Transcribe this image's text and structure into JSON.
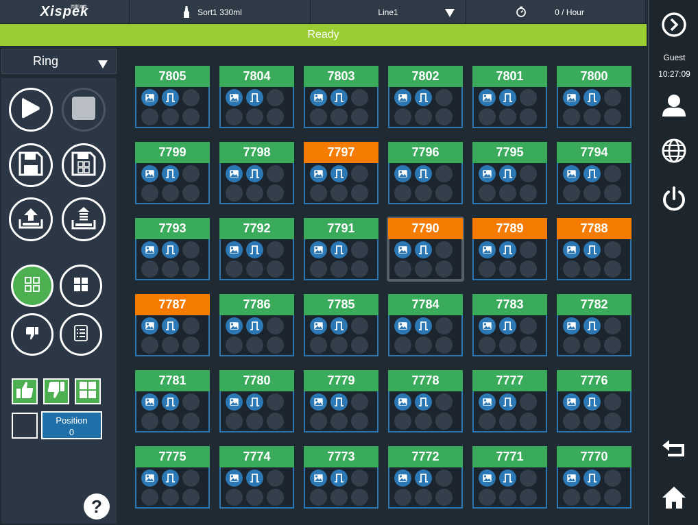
{
  "header": {
    "logo": "Xispek",
    "logo_sub": "西斯派克",
    "product": "Sort1 330ml",
    "line": "Line1",
    "rate": "0 / Hour",
    "status": "Ready",
    "status_color": "#9acd32"
  },
  "left": {
    "mode": "Ring",
    "position_label": "Position",
    "position_value": "0",
    "help": "?"
  },
  "right": {
    "user": "Guest",
    "time": "10:27:09"
  },
  "colors": {
    "ok": "#3aab5b",
    "reject": "#f57c00",
    "border": "#2b78b5"
  },
  "cells": [
    {
      "id": "7805",
      "status": "ok"
    },
    {
      "id": "7804",
      "status": "ok"
    },
    {
      "id": "7803",
      "status": "ok"
    },
    {
      "id": "7802",
      "status": "ok"
    },
    {
      "id": "7801",
      "status": "ok"
    },
    {
      "id": "7800",
      "status": "ok"
    },
    {
      "id": "7799",
      "status": "ok"
    },
    {
      "id": "7798",
      "status": "ok"
    },
    {
      "id": "7797",
      "status": "reject"
    },
    {
      "id": "7796",
      "status": "ok"
    },
    {
      "id": "7795",
      "status": "ok"
    },
    {
      "id": "7794",
      "status": "ok"
    },
    {
      "id": "7793",
      "status": "ok"
    },
    {
      "id": "7792",
      "status": "ok"
    },
    {
      "id": "7791",
      "status": "ok"
    },
    {
      "id": "7790",
      "status": "reject",
      "selected": true
    },
    {
      "id": "7789",
      "status": "reject"
    },
    {
      "id": "7788",
      "status": "reject"
    },
    {
      "id": "7787",
      "status": "reject"
    },
    {
      "id": "7786",
      "status": "ok"
    },
    {
      "id": "7785",
      "status": "ok"
    },
    {
      "id": "7784",
      "status": "ok"
    },
    {
      "id": "7783",
      "status": "ok"
    },
    {
      "id": "7782",
      "status": "ok"
    },
    {
      "id": "7781",
      "status": "ok"
    },
    {
      "id": "7780",
      "status": "ok"
    },
    {
      "id": "7779",
      "status": "ok"
    },
    {
      "id": "7778",
      "status": "ok"
    },
    {
      "id": "7777",
      "status": "ok"
    },
    {
      "id": "7776",
      "status": "ok"
    },
    {
      "id": "7775",
      "status": "ok"
    },
    {
      "id": "7774",
      "status": "ok"
    },
    {
      "id": "7773",
      "status": "ok"
    },
    {
      "id": "7772",
      "status": "ok"
    },
    {
      "id": "7771",
      "status": "ok"
    },
    {
      "id": "7770",
      "status": "ok"
    }
  ]
}
